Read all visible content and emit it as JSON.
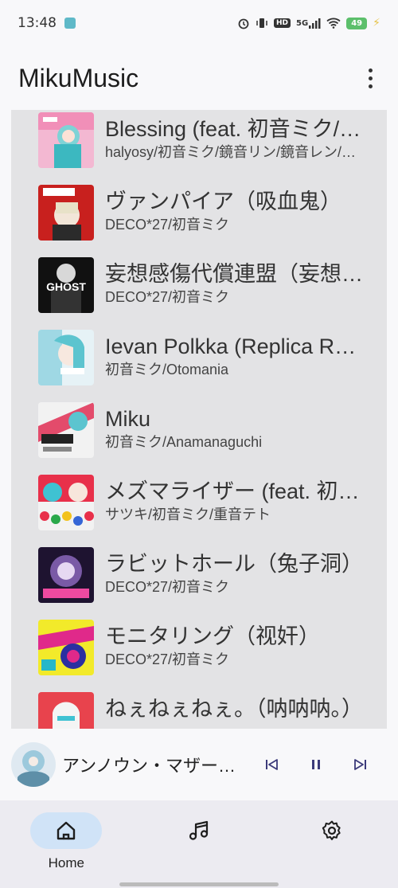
{
  "status_bar": {
    "time": "13:48",
    "network": "5G",
    "hd": "HD",
    "battery": "49"
  },
  "app_bar": {
    "title": "MikuMusic"
  },
  "songs": [
    {
      "title": "Blessing (feat. 初音ミク/鏡音リン/鏡音レン/巡音ルカ/MEIKO/KAITO)",
      "artist": "halyosy/初音ミク/鏡音リン/鏡音レン/巡音ルカ/MEIKO/KAITO"
    },
    {
      "title": "ヴァンパイア（吸血鬼）",
      "artist": "DECO*27/初音ミク"
    },
    {
      "title": "妄想感傷代償連盟（妄想感伤代偿联盟）",
      "artist": "DECO*27/初音ミク"
    },
    {
      "title": "Ievan Polkka (Replica Remix)",
      "artist": "初音ミク/Otomania"
    },
    {
      "title": "Miku",
      "artist": "初音ミク/Anamanaguchi"
    },
    {
      "title": "メズマライザー (feat. 初音ミク & 重音テト)",
      "artist": "サツキ/初音ミク/重音テト"
    },
    {
      "title": "ラビットホール（兔子洞）",
      "artist": "DECO*27/初音ミク"
    },
    {
      "title": "モニタリング（视奸）",
      "artist": "DECO*27/初音ミク"
    },
    {
      "title": "ねぇねぇねぇ。（呐呐呐。）",
      "artist": ""
    }
  ],
  "now_playing": {
    "title": "アンノウン・マザーグース"
  },
  "nav": {
    "home_label": "Home"
  }
}
